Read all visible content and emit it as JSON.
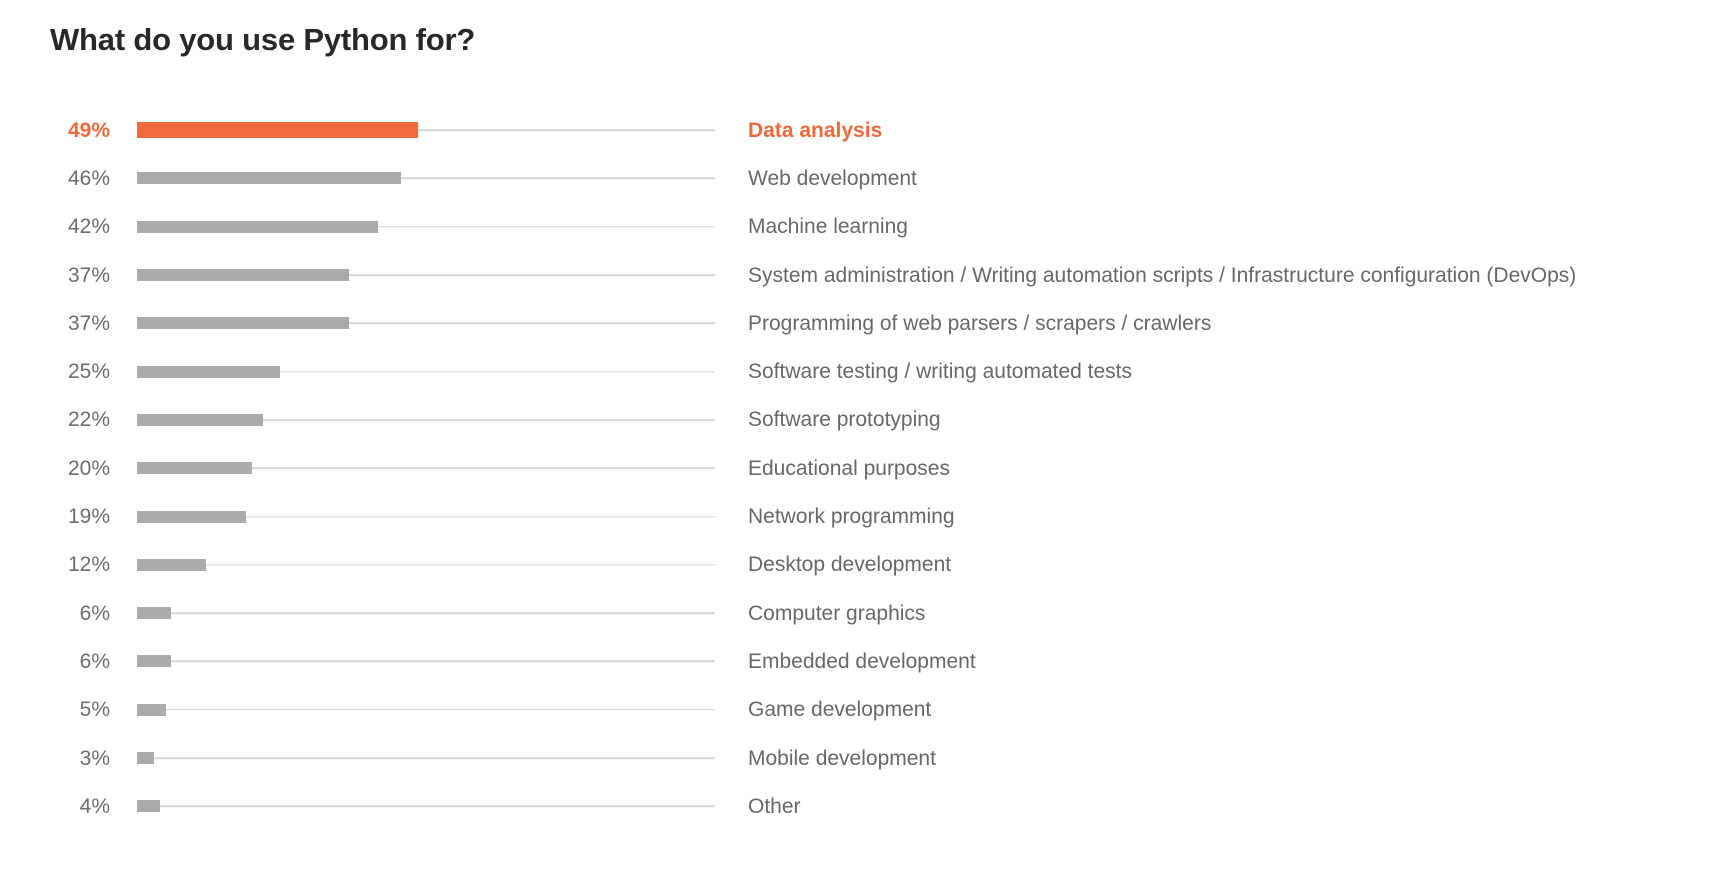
{
  "chart_data": {
    "type": "bar",
    "title": "What do you use Python for?",
    "orientation": "horizontal",
    "xlabel": "",
    "ylabel": "",
    "xlim": [
      0,
      60
    ],
    "grid": false,
    "legend": null,
    "value_suffix": "%",
    "highlight_index": 0,
    "categories": [
      "Data analysis",
      "Web development",
      "Machine learning",
      "System administration / Writing automation scripts / Infrastructure configuration (DevOps)",
      "Programming of web parsers / scrapers / crawlers",
      "Software testing / writing automated tests",
      "Software prototyping",
      "Educational purposes",
      "Network programming",
      "Desktop development",
      "Computer graphics",
      "Embedded development",
      "Game development",
      "Mobile development",
      "Other"
    ],
    "values": [
      49,
      46,
      42,
      37,
      37,
      25,
      22,
      20,
      19,
      12,
      6,
      6,
      5,
      3,
      4
    ],
    "value_labels": [
      "49%",
      "46%",
      "42%",
      "37%",
      "37%",
      "25%",
      "22%",
      "20%",
      "19%",
      "12%",
      "6%",
      "6%",
      "5%",
      "3%",
      "4%"
    ]
  },
  "colors": {
    "highlight": "#ef6a3c",
    "bar": "#a9abad",
    "track": "#d3d5d7",
    "text": "#65686c",
    "title": "#26282c",
    "background": "#ffffff"
  }
}
